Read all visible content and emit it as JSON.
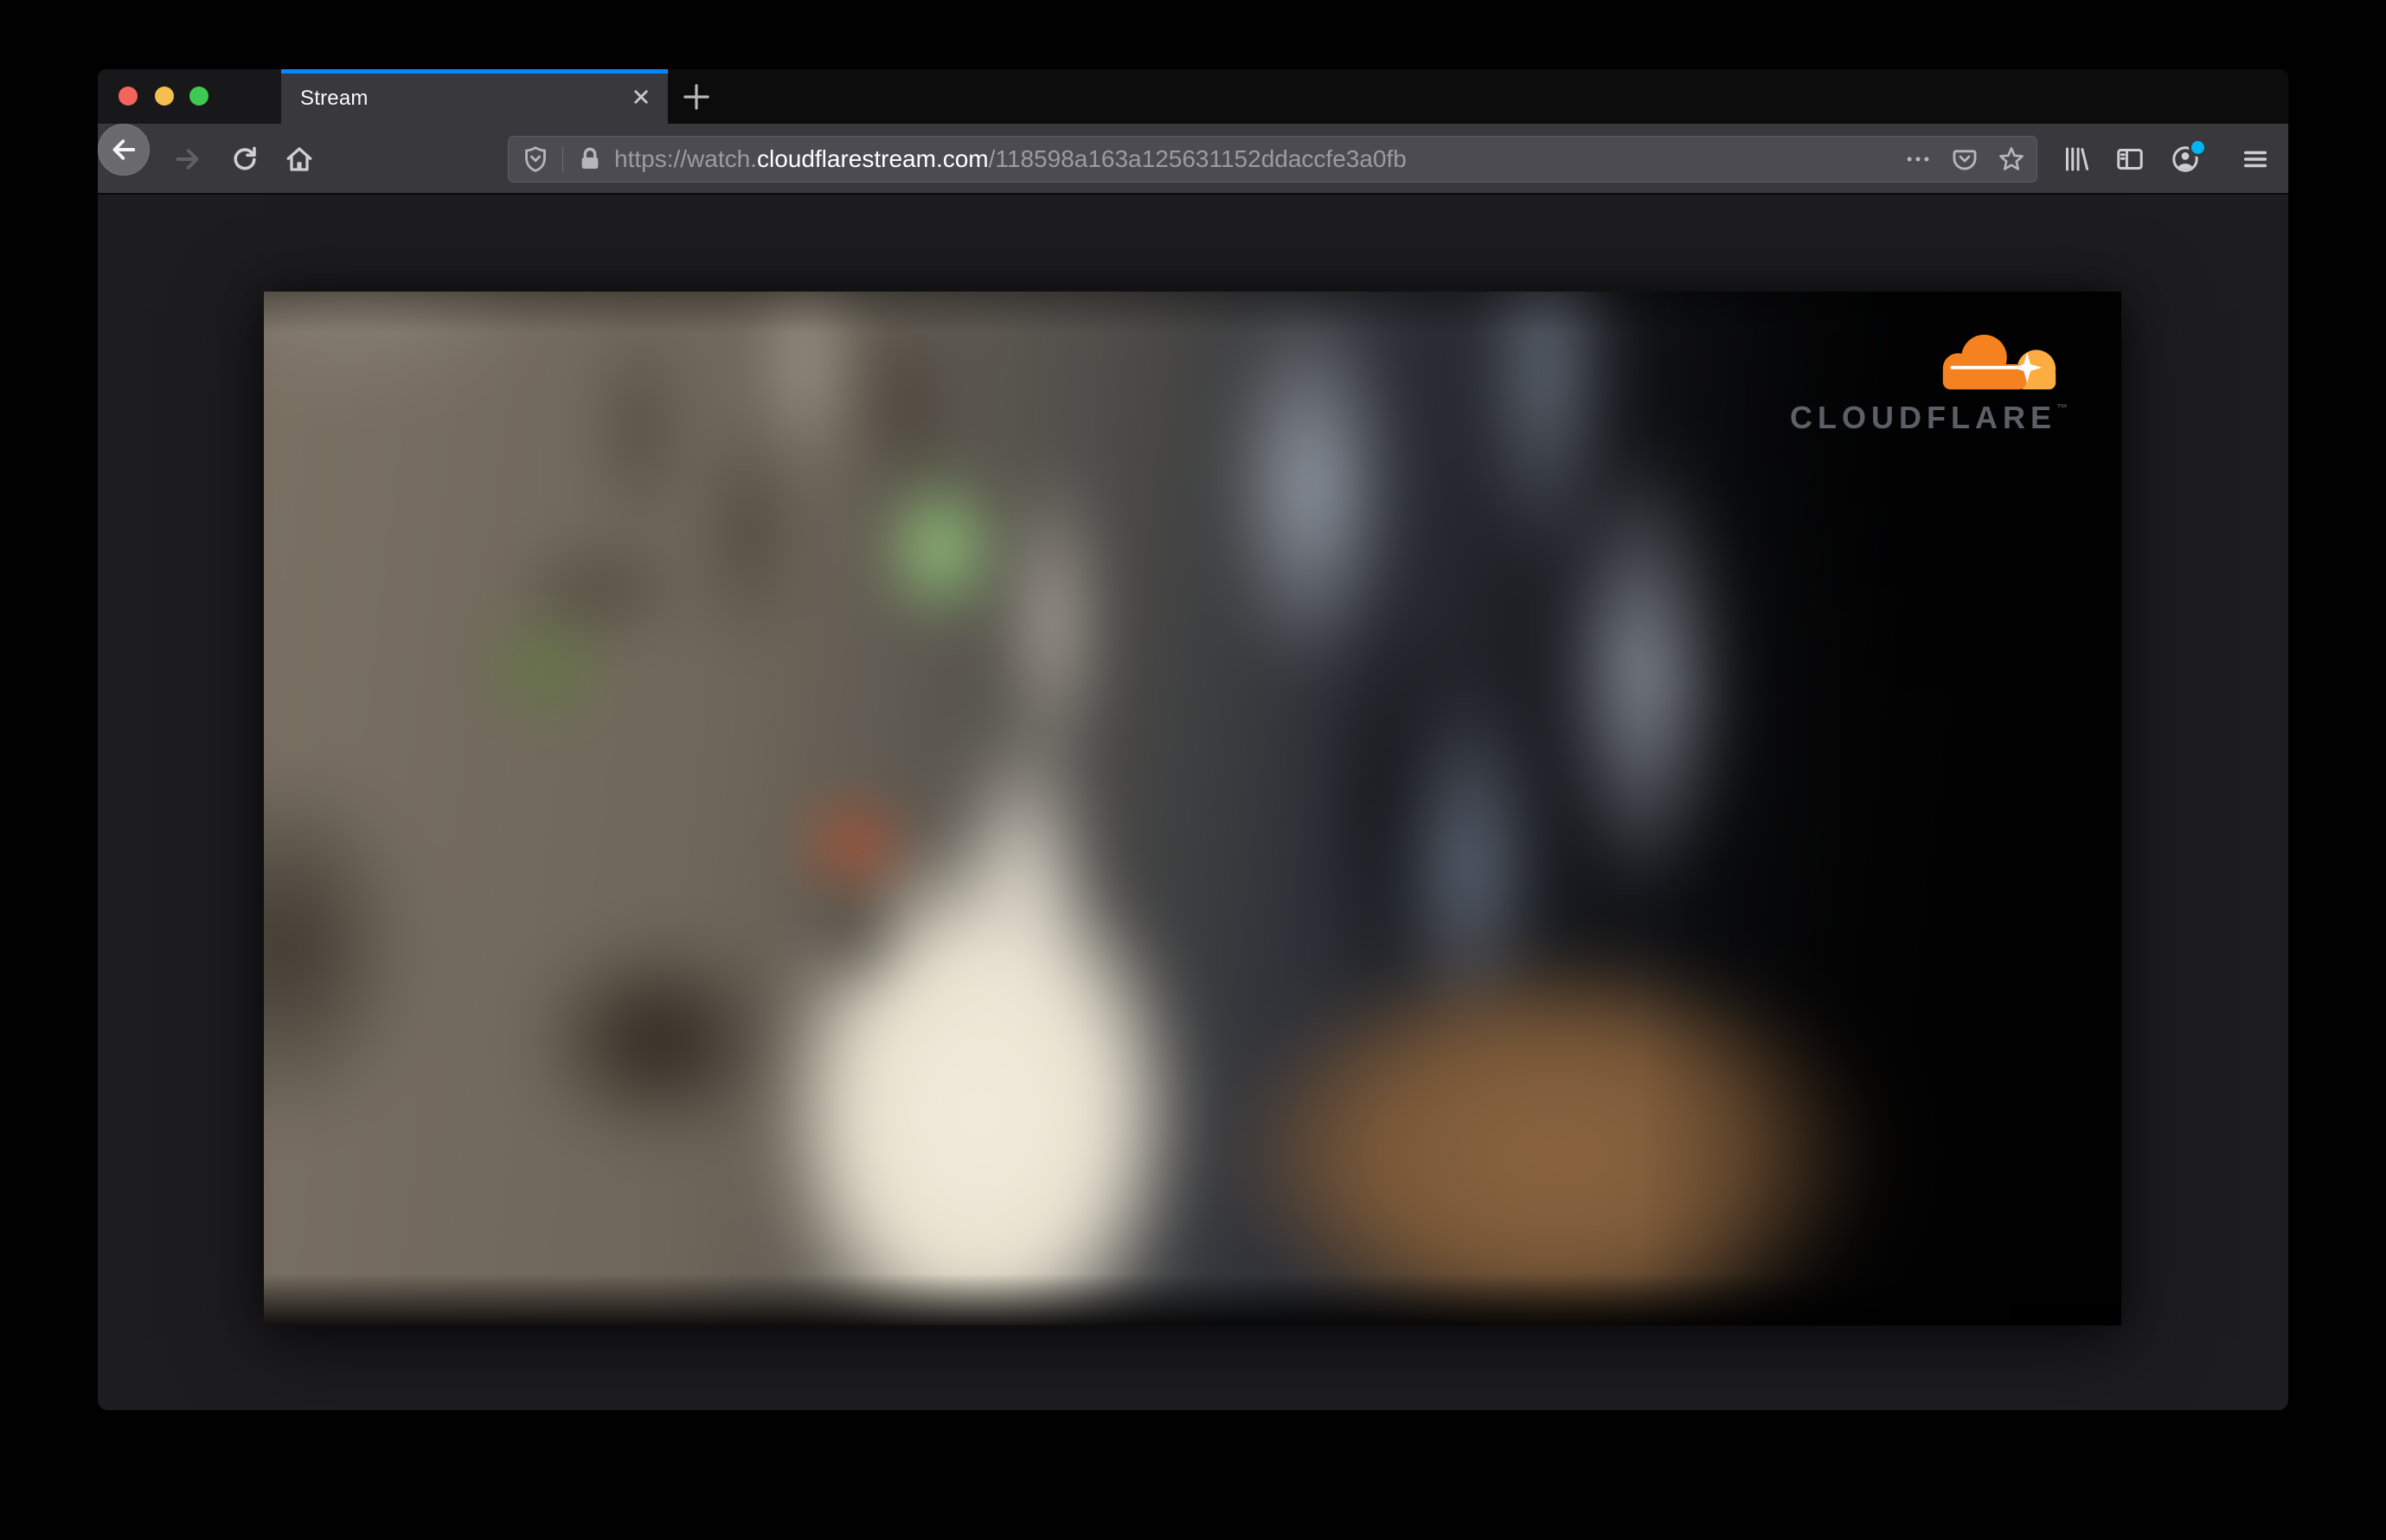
{
  "browser": {
    "window_controls": {
      "close": "close",
      "minimize": "minimize",
      "zoom": "zoom"
    },
    "tab": {
      "title": "Stream"
    },
    "address_bar": {
      "url_prefix": "https://watch.",
      "url_domain": "cloudflarestream.com",
      "url_path": "/118598a163a125631152ddaccfe3a0fb",
      "full_url": "https://watch.cloudflarestream.com/118598a163a125631152ddaccfe3a0fb"
    },
    "icons": [
      "back-icon",
      "forward-icon",
      "reload-icon",
      "home-icon",
      "tracking-protection-shield-icon",
      "lock-icon",
      "page-actions-dots-icon",
      "pocket-icon",
      "bookmark-star-icon",
      "library-icon",
      "sidebar-icon",
      "account-icon",
      "menu-icon",
      "tab-close-icon",
      "new-tab-plus-icon"
    ]
  },
  "page": {
    "player_brand": "CLOUDFLARE",
    "player_brand_mark": "™"
  },
  "colors": {
    "accent_blue": "#0a84ff",
    "traffic_red": "#f4645c",
    "traffic_yellow": "#f5bf4f",
    "traffic_green": "#3ec953",
    "notification_blue": "#00b3f4",
    "cloudflare_orange": "#f6821f",
    "cloudflare_orange_light": "#fbad41",
    "cloudflare_wordmark_gray": "#5b6067"
  }
}
